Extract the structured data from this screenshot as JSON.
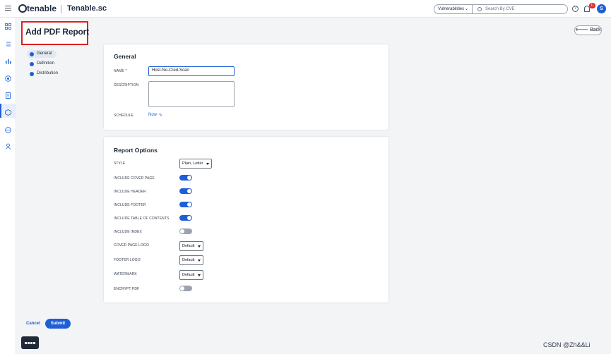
{
  "header": {
    "logo_text": "tenable",
    "product_name": "Tenable.sc",
    "module_select": "Vulnerabilities",
    "search_placeholder": "Search By CVE",
    "notification_count": "11",
    "user_initial": "S",
    "help_label": "?"
  },
  "page": {
    "title": "Add PDF Report",
    "back_label": "Back"
  },
  "steps": [
    {
      "label": "General",
      "active": true
    },
    {
      "label": "Definition",
      "active": false
    },
    {
      "label": "Distribution",
      "active": false
    }
  ],
  "general": {
    "title": "General",
    "name_label": "NAME *",
    "name_value": "Host-No-Cred-Scan",
    "description_label": "DESCRIPTION",
    "description_value": "",
    "schedule_label": "SCHEDULE",
    "schedule_value": "Now"
  },
  "report_options": {
    "title": "Report Options",
    "style_label": "STYLE",
    "style_value": "Plain, Letter",
    "cover_page_label": "INCLUDE COVER PAGE",
    "cover_page_on": true,
    "header_label": "INCLUDE HEADER",
    "header_on": true,
    "footer_label": "INCLUDE FOOTER",
    "footer_on": true,
    "toc_label": "INCLUDE TABLE OF CONTENTS",
    "toc_on": true,
    "index_label": "INCLUDE INDEX",
    "index_on": false,
    "cover_logo_label": "COVER PAGE LOGO",
    "cover_logo_value": "Default",
    "footer_logo_label": "FOOTER LOGO",
    "footer_logo_value": "Default",
    "watermark_label": "WATERMARK",
    "watermark_value": "Default",
    "encrypt_label": "ENCRYPT PDF",
    "encrypt_on": false
  },
  "actions": {
    "cancel_label": "Cancel",
    "submit_label": "Submit"
  },
  "overlay_watermark": "CSDN @Zh&&Li",
  "colors": {
    "accent": "#1f5fd6",
    "highlight_border": "#e02020",
    "toggle_off": "#9ca3af"
  }
}
